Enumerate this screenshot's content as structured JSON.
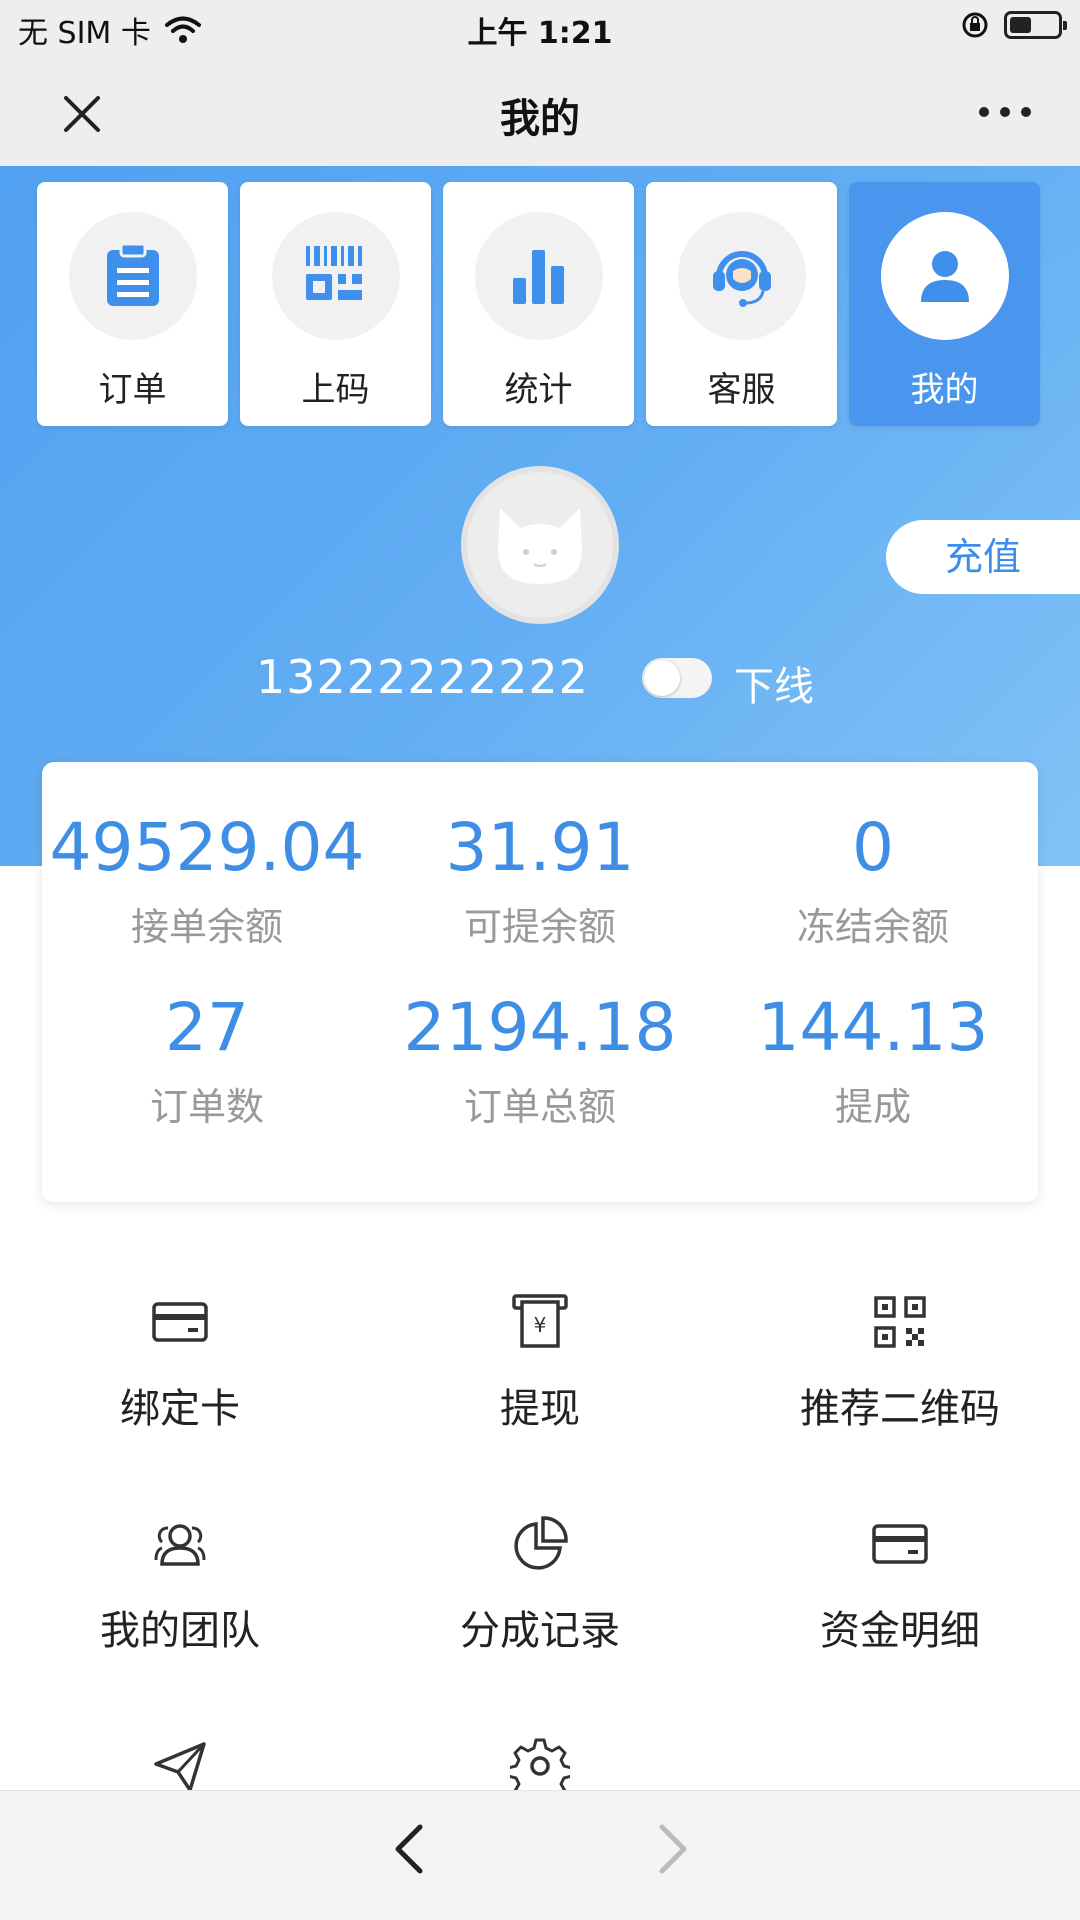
{
  "status_bar": {
    "carrier": "无 SIM 卡",
    "time": "上午 1:21",
    "battery_level": 0.45
  },
  "nav": {
    "title": "我的"
  },
  "tabs": [
    {
      "label": "订单",
      "icon": "clipboard-icon",
      "active": false
    },
    {
      "label": "上码",
      "icon": "barcode-icon",
      "active": false
    },
    {
      "label": "统计",
      "icon": "bar-chart-icon",
      "active": false
    },
    {
      "label": "客服",
      "icon": "headset-icon",
      "active": false
    },
    {
      "label": "我的",
      "icon": "user-icon",
      "active": true
    }
  ],
  "profile": {
    "phone": "13222222222",
    "status_label": "下线",
    "online": false,
    "recharge_label": "充值"
  },
  "stats": [
    {
      "value": "49529.04",
      "label": "接单余额"
    },
    {
      "value": "31.91",
      "label": "可提余额"
    },
    {
      "value": "0",
      "label": "冻结余额"
    },
    {
      "value": "27",
      "label": "订单数"
    },
    {
      "value": "2194.18",
      "label": "订单总额"
    },
    {
      "value": "144.13",
      "label": "提成"
    }
  ],
  "menu": [
    {
      "label": "绑定卡",
      "icon": "bank-card-icon"
    },
    {
      "label": "提现",
      "icon": "withdraw-icon"
    },
    {
      "label": "推荐二维码",
      "icon": "qr-code-icon"
    },
    {
      "label": "我的团队",
      "icon": "team-icon"
    },
    {
      "label": "分成记录",
      "icon": "pie-chart-icon"
    },
    {
      "label": "资金明细",
      "icon": "wallet-card-icon"
    },
    {
      "label": "",
      "icon": "send-icon"
    },
    {
      "label": "",
      "icon": "settings-gear-icon"
    }
  ],
  "colors": {
    "accent": "#3e8ee6",
    "header_blue": "#4c9bf0",
    "active_tab": "#4a95ee"
  }
}
